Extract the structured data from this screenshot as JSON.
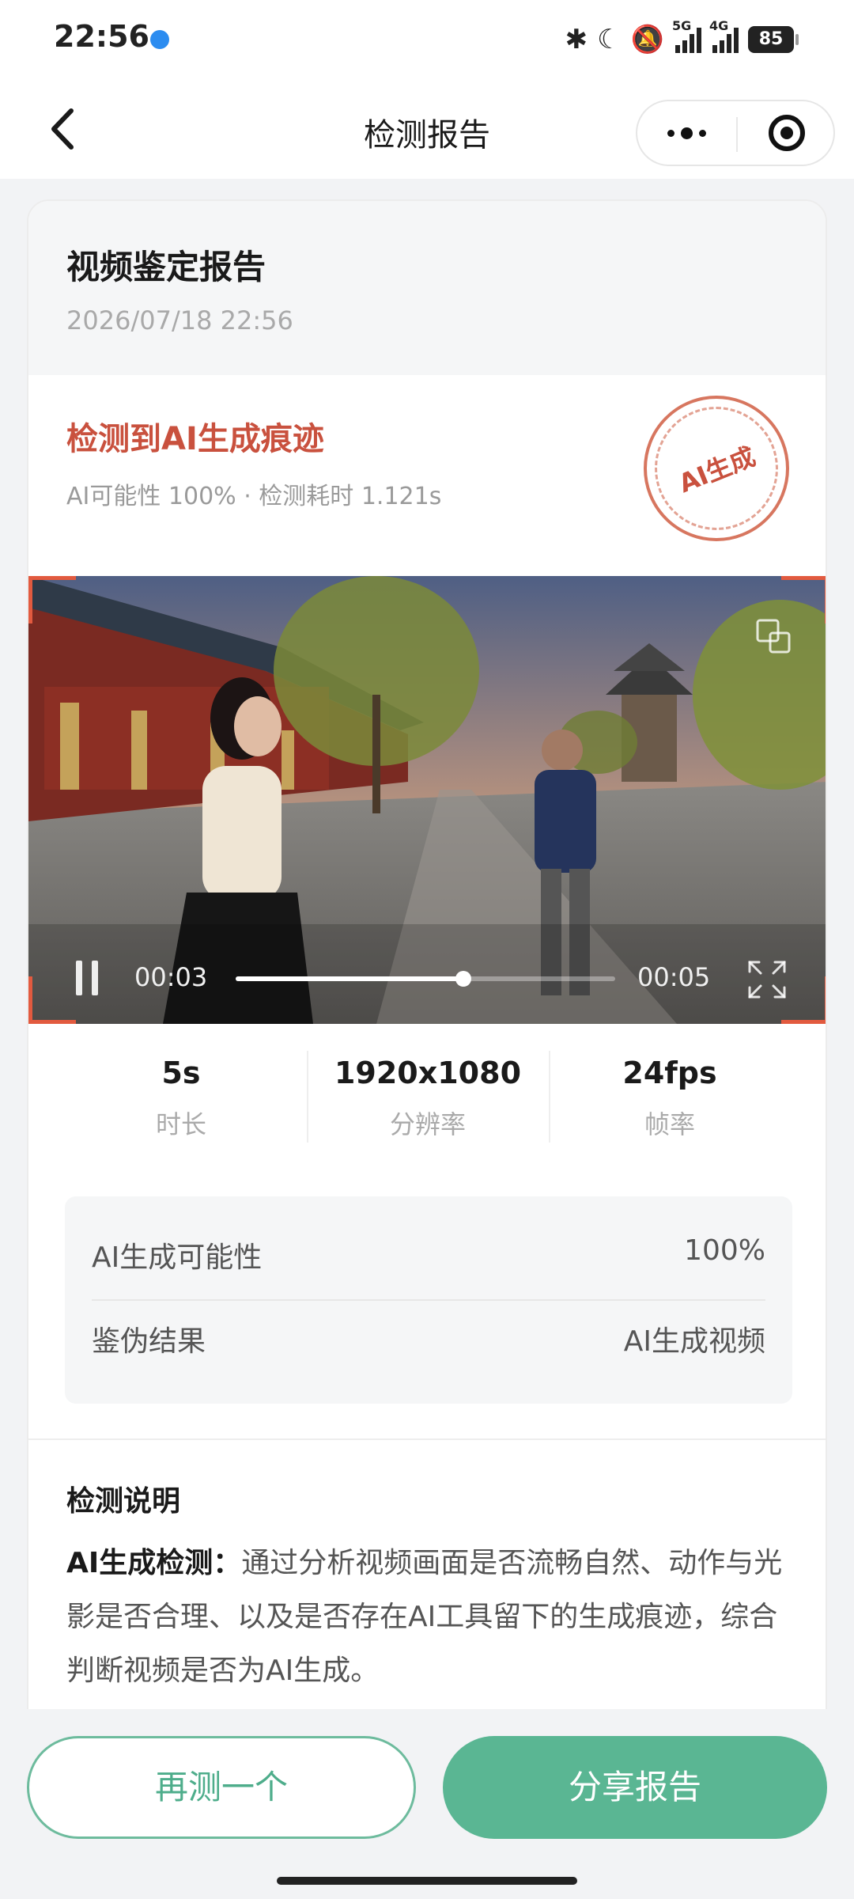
{
  "status_bar": {
    "time": "22:56",
    "icons": [
      "notification-dot-icon",
      "bluetooth-icon",
      "moon-icon",
      "mute-icon",
      "signal-5g-icon",
      "signal-4g-icon",
      "battery-icon"
    ],
    "signal_tags": [
      "5G",
      "4G"
    ],
    "battery_level": "85"
  },
  "nav": {
    "title": "检测报告"
  },
  "report": {
    "title": "视频鉴定报告",
    "datetime": "2026/07/18 22:56"
  },
  "result": {
    "headline": "检测到AI生成痕迹",
    "subline": "AI可能性 100% · 检测耗时 1.121s",
    "stamp_text": "AI生成",
    "accent_color": "#c9513e"
  },
  "video": {
    "current_time": "00:03",
    "total_time": "00:05",
    "progress": 0.6,
    "playing": true
  },
  "stats": [
    {
      "value": "5s",
      "label": "时长"
    },
    {
      "value": "1920x1080",
      "label": "分辨率"
    },
    {
      "value": "24fps",
      "label": "帧率"
    }
  ],
  "summary": [
    {
      "key": "AI生成可能性",
      "value": "100%"
    },
    {
      "key": "鉴伪结果",
      "value": "AI生成视频"
    }
  ],
  "description": {
    "title": "检测说明",
    "lead": "AI生成检测：",
    "body": "通过分析视频画面是否流畅自然、动作与光影是否合理、以及是否存在AI工具留下的生成痕迹，综合判断视频是否为AI生成。"
  },
  "actions": {
    "retest_label": "再测一个",
    "share_label": "分享报告",
    "brand_color": "#5ab693"
  }
}
